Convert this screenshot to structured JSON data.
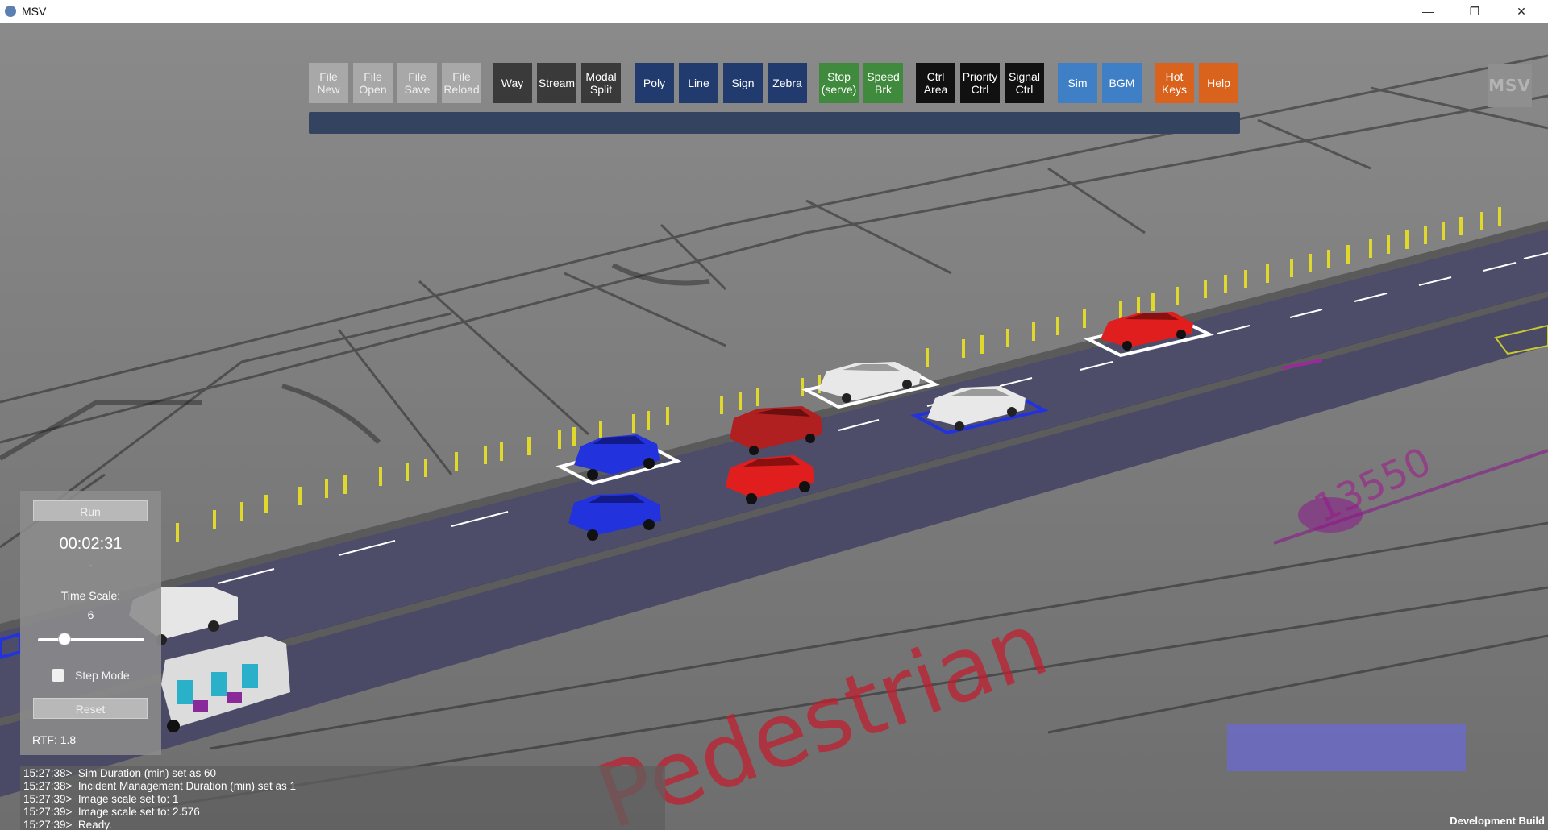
{
  "window": {
    "title": "MSV",
    "controls": {
      "minimize": "—",
      "maximize": "❐",
      "close": "✕"
    }
  },
  "toolbar": {
    "file_new": "File\nNew",
    "file_open": "File\nOpen",
    "file_save": "File\nSave",
    "file_reload": "File\nReload",
    "way": "Way",
    "stream": "Stream",
    "modal_split": "Modal\nSplit",
    "poly": "Poly",
    "line": "Line",
    "sign": "Sign",
    "zebra": "Zebra",
    "stop_serve": "Stop\n(serve)",
    "speed_brk": "Speed\nBrk",
    "ctrl_area": "Ctrl\nArea",
    "priority_ctrl": "Priority\nCtrl",
    "signal_ctrl": "Signal\nCtrl",
    "sim": "Sim",
    "bgm": "BGM",
    "hot_keys": "Hot\nKeys",
    "help": "Help"
  },
  "logo": {
    "text": "MSV"
  },
  "control_panel": {
    "run_label": "Run",
    "elapsed_time": "00:02:31",
    "time_sub": "-",
    "time_scale_label": "Time Scale:",
    "time_scale_value": "6",
    "time_scale_level": 0.25,
    "step_mode_label": "Step Mode",
    "step_mode_checked": false,
    "reset_label": "Reset",
    "rtf_label": "RTF: 1.8"
  },
  "console": {
    "lines": [
      "15:27:38>  Sim Duration (min) set as 60",
      "15:27:38>  Incident Management Duration (min) set as 1",
      "15:27:39>  Image scale set to: 1",
      "15:27:39>  Image scale set to: 2.576",
      "15:27:39>  Ready."
    ]
  },
  "scene": {
    "map_labels": {
      "pedestrian": "Pedestrian",
      "dimension": "13550"
    },
    "vehicle_colors": {
      "red": "#e01e1e",
      "blue": "#2233dd",
      "white": "#e8e8e8",
      "darkred": "#b02020"
    },
    "road_color": "#4a4a66",
    "bollard_color": "#e0d82a"
  },
  "status": {
    "build": "Development Build"
  }
}
